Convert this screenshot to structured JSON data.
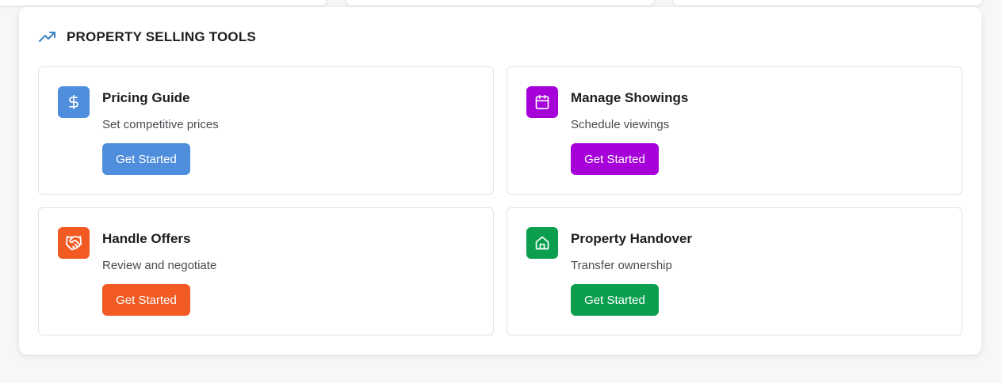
{
  "section": {
    "title": "PROPERTY SELLING TOOLS",
    "icon": "trending-up-icon",
    "icon_color": "#3b82c4"
  },
  "tools": [
    {
      "title": "Pricing Guide",
      "description": "Set competitive prices",
      "button_label": "Get Started",
      "icon": "dollar-icon",
      "color": "#4f8ddd"
    },
    {
      "title": "Manage Showings",
      "description": "Schedule viewings",
      "button_label": "Get Started",
      "icon": "calendar-icon",
      "color": "#a600d9"
    },
    {
      "title": "Handle Offers",
      "description": "Review and negotiate",
      "button_label": "Get Started",
      "icon": "handshake-icon",
      "color": "#f15a22"
    },
    {
      "title": "Property Handover",
      "description": "Transfer ownership",
      "button_label": "Get Started",
      "icon": "home-icon",
      "color": "#0b9e4f"
    }
  ]
}
